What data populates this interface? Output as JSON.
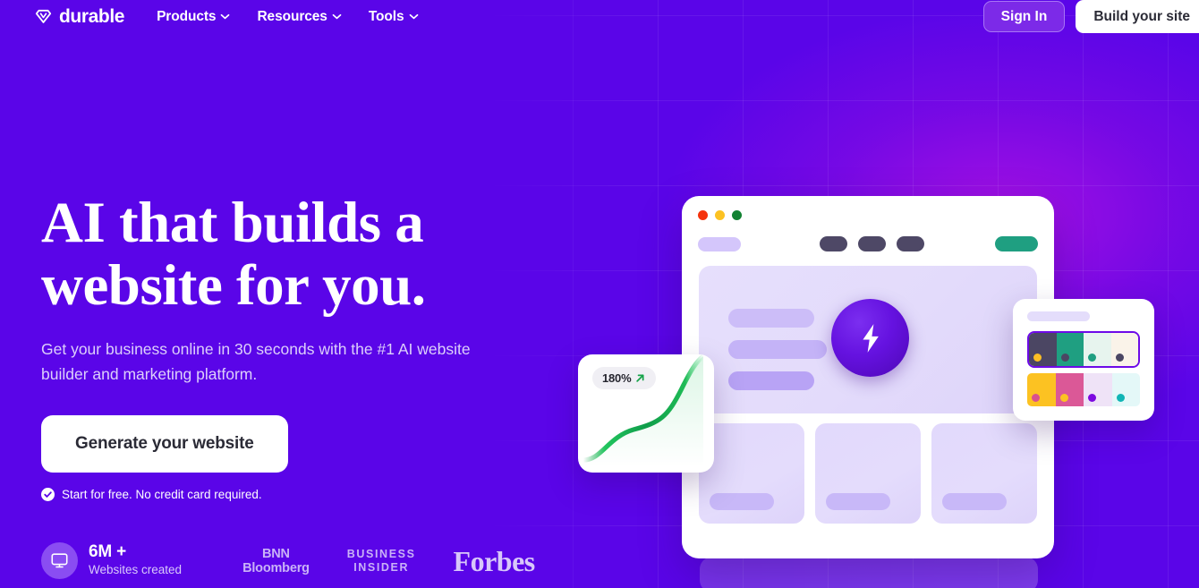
{
  "brand": {
    "name": "durable",
    "logo_icon": "gem-diamond-icon"
  },
  "nav": {
    "links": [
      {
        "label": "Products",
        "icon": "chevron-down-icon"
      },
      {
        "label": "Resources",
        "icon": "chevron-down-icon"
      },
      {
        "label": "Tools",
        "icon": "chevron-down-icon"
      }
    ],
    "sign_in_label": "Sign In",
    "build_site_label": "Build your site"
  },
  "hero": {
    "headline_line1": "AI that builds a",
    "headline_line2": "website for you.",
    "subhead": "Get your business online in 30 seconds with the #1 AI website builder and marketing platform.",
    "cta_label": "Generate your website",
    "trust_text": "Start for free. No credit card required.",
    "trust_icon": "check-circle-icon"
  },
  "proof": {
    "stat_icon": "monitor-icon",
    "stat_value": "6M +",
    "stat_label": "Websites created",
    "logos": [
      {
        "name": "bnn-bloomberg-logo",
        "line1": "BNN",
        "line2": "Bloomberg"
      },
      {
        "name": "business-insider-logo",
        "line1": "BUSINESS",
        "line2": "INSIDER"
      },
      {
        "name": "forbes-logo",
        "text": "Forbes"
      }
    ]
  },
  "mockup": {
    "traffic_lights": [
      "#f5330c",
      "#fcc222",
      "#128232"
    ],
    "nav_cta_color": "#1f9f81",
    "bolt_icon": "lightning-bolt-icon",
    "card_count": 3
  },
  "chart_card": {
    "badge_value": "180%",
    "badge_icon": "arrow-up-right-icon",
    "line_color": "#16a34a"
  },
  "palette_card": {
    "rows": [
      {
        "selected": true,
        "swatches": [
          {
            "bg": "#4b4663",
            "dot": "#fbbf24"
          },
          {
            "bg": "#1f9f81",
            "dot": "#4b4663"
          },
          {
            "bg": "#e7f4ee",
            "dot": "#1f9f81"
          },
          {
            "bg": "#faf3e9",
            "dot": "#4b4663"
          }
        ]
      },
      {
        "selected": false,
        "swatches": [
          {
            "bg": "#fcc222",
            "dot": "#d9508f"
          },
          {
            "bg": "#db5897",
            "dot": "#fcc222"
          },
          {
            "bg": "#efe3f7",
            "dot": "#7c0ae0"
          },
          {
            "bg": "#e4f8f8",
            "dot": "#11b5b5"
          }
        ]
      }
    ]
  },
  "colors": {
    "brand_purple": "#5a05e8",
    "accent_magenta": "#b012e2",
    "white": "#ffffff",
    "green": "#16a34a"
  }
}
